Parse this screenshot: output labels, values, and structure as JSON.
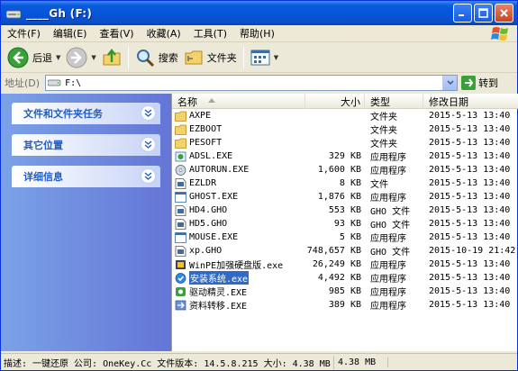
{
  "window": {
    "title": "_Gh (F:)",
    "title_prefix": "___"
  },
  "menu": [
    "文件(F)",
    "编辑(E)",
    "查看(V)",
    "收藏(A)",
    "工具(T)",
    "帮助(H)"
  ],
  "toolbar": {
    "back": "后退",
    "search": "搜索",
    "folders": "文件夹"
  },
  "address": {
    "label": "地址(D)",
    "value": "F:\\",
    "go": "转到"
  },
  "tasks": [
    {
      "title": "文件和文件夹任务"
    },
    {
      "title": "其它位置"
    },
    {
      "title": "详细信息"
    }
  ],
  "columns": {
    "name": "名称",
    "size": "大小",
    "type": "类型",
    "date": "修改日期"
  },
  "files": [
    {
      "name": "AXPE",
      "size": "",
      "type": "文件夹",
      "date": "2015-5-13 13:40",
      "icon": "folder-icon"
    },
    {
      "name": "EZBOOT",
      "size": "",
      "type": "文件夹",
      "date": "2015-5-13 13:40",
      "icon": "folder-icon"
    },
    {
      "name": "PESOFT",
      "size": "",
      "type": "文件夹",
      "date": "2015-5-13 13:40",
      "icon": "folder-icon"
    },
    {
      "name": "ADSL.EXE",
      "size": "329 KB",
      "type": "应用程序",
      "date": "2015-5-13 13:40",
      "icon": "network-icon"
    },
    {
      "name": "AUTORUN.EXE",
      "size": "1,600 KB",
      "type": "应用程序",
      "date": "2015-5-13 13:40",
      "icon": "disc-icon"
    },
    {
      "name": "EZLDR",
      "size": "8 KB",
      "type": "文件",
      "date": "2015-5-13 13:40",
      "icon": "file-icon"
    },
    {
      "name": "GHOST.EXE",
      "size": "1,876 KB",
      "type": "应用程序",
      "date": "2015-5-13 13:40",
      "icon": "app-icon"
    },
    {
      "name": "HD4.GHO",
      "size": "553 KB",
      "type": "GHO 文件",
      "date": "2015-5-13 13:40",
      "icon": "file-icon"
    },
    {
      "name": "HD5.GHO",
      "size": "93 KB",
      "type": "GHO 文件",
      "date": "2015-5-13 13:40",
      "icon": "file-icon"
    },
    {
      "name": "MOUSE.EXE",
      "size": "5 KB",
      "type": "应用程序",
      "date": "2015-5-13 13:40",
      "icon": "app-icon"
    },
    {
      "name": "xp.GHO",
      "size": "748,657 KB",
      "type": "GHO 文件",
      "date": "2015-10-19 21:42",
      "icon": "file-icon"
    },
    {
      "name": "WinPE加强硬盘版.exe",
      "size": "26,249 KB",
      "type": "应用程序",
      "date": "2015-5-13 13:40",
      "icon": "pe-icon"
    },
    {
      "name": "安装系统.exe",
      "size": "4,492 KB",
      "type": "应用程序",
      "date": "2015-5-13 13:40",
      "icon": "install-icon",
      "selected": true
    },
    {
      "name": "驱动精灵.EXE",
      "size": "985 KB",
      "type": "应用程序",
      "date": "2015-5-13 13:40",
      "icon": "driver-icon"
    },
    {
      "name": "资料转移.EXE",
      "size": "389 KB",
      "type": "应用程序",
      "date": "2015-5-13 13:40",
      "icon": "transfer-icon"
    }
  ],
  "status": {
    "desc": "描述: 一键还原 公司: OneKey.Cc 文件版本: 14.5.8.215 大小: 4.38 MB",
    "size": "4.38 MB"
  }
}
